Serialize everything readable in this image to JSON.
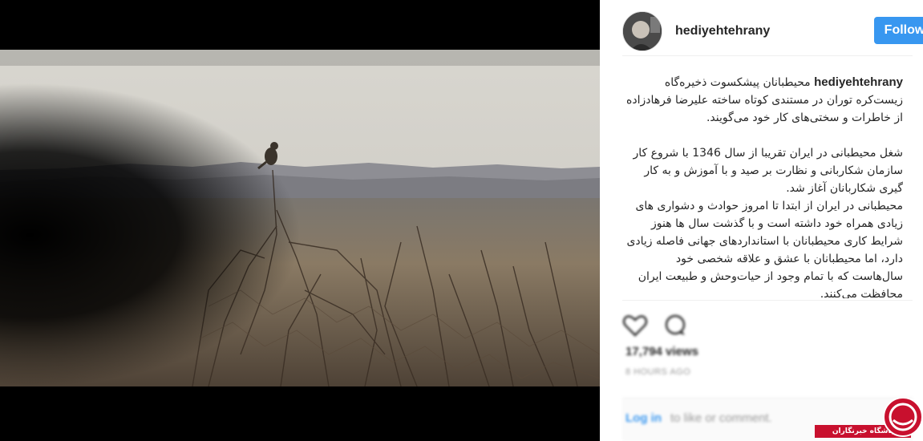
{
  "post": {
    "username": "hediyehtehrany",
    "follow_label": "Follow"
  },
  "caption": {
    "username": "hediyehtehrany",
    "p1": "محیطبانان پیشکسوت ذخیره‌گاه زیست‌کره توران در مستندی کوتاه ساخته علیرضا فرهادزاده از خاطرات و سختی‌های کار خود می‌گویند.",
    "p2": "شغل محیطبانی در ایران تقریبا از سال 1346 با شروع کار سازمان شکاربانی و نظارت بر صید و با آموزش و به کار گیری شکاربانان آغاز شد.",
    "p3": "محیطبانی در ایران از ابتدا تا امروز حوادث و دشواری های زیادی همراه خود داشته است و با گذشت سال ها هنوز شرایط کاری محیطبانان با استانداردهای جهانی فاصله زیادی دارد، اما محیطبانان با عشق و علاقه شخصی خود سال‌هاست که با تمام وجود از حیات‌وحش و طبیعت ایران محافظت می‌کنند."
  },
  "actions": {
    "heart_icon": "heart-icon",
    "comment_icon": "comment-icon",
    "views": "17,794 views",
    "time": "8 HOURS AGO",
    "login_link": "Log in",
    "login_rest": "to like or comment."
  },
  "watermark": {
    "text": "باشگاه خبرنگاران"
  },
  "colors": {
    "follow_bg": "#3897f0",
    "watermark_red": "#c8102e"
  }
}
